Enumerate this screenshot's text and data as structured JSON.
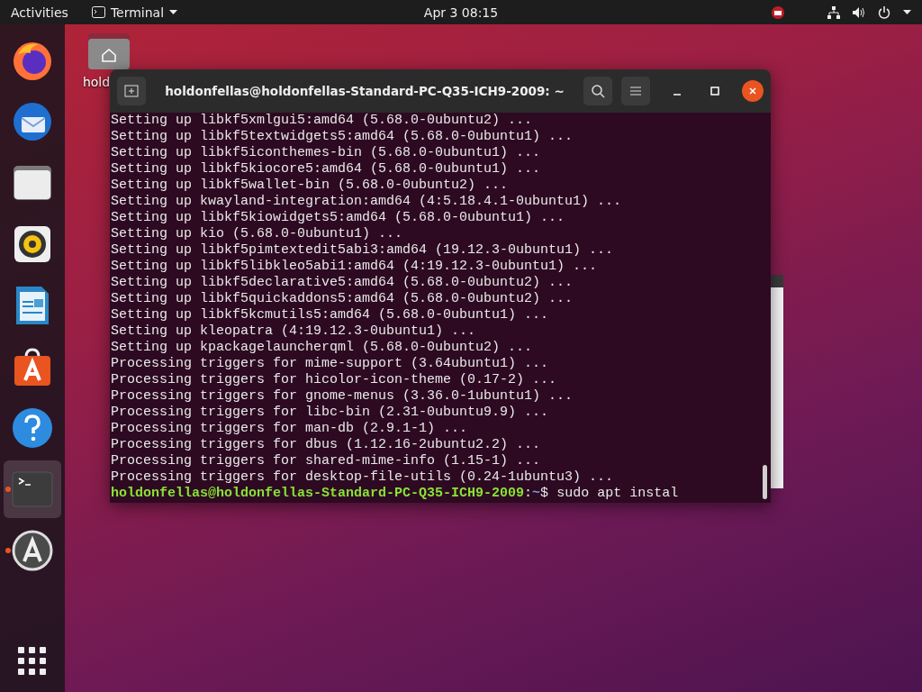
{
  "top_bar": {
    "activities": "Activities",
    "app_menu": "Terminal",
    "clock": "Apr 3  08:15"
  },
  "dock": {
    "items": [
      {
        "kind": "firefox",
        "running": false,
        "selected": false
      },
      {
        "kind": "mail",
        "running": false,
        "selected": false
      },
      {
        "kind": "files",
        "running": false,
        "selected": false
      },
      {
        "kind": "music",
        "running": false,
        "selected": false
      },
      {
        "kind": "writer",
        "running": false,
        "selected": false
      },
      {
        "kind": "store",
        "running": false,
        "selected": false
      },
      {
        "kind": "help",
        "running": false,
        "selected": false
      },
      {
        "kind": "terminal",
        "running": true,
        "selected": true
      },
      {
        "kind": "updater",
        "running": true,
        "selected": false
      }
    ]
  },
  "desktop_icon": {
    "label": "hold"
  },
  "terminal": {
    "title": "holdonfellas@holdonfellas-Standard-PC-Q35-ICH9-2009: ~",
    "lines": [
      "Setting up libkf5xmlgui5:amd64 (5.68.0-0ubuntu2) ...",
      "Setting up libkf5textwidgets5:amd64 (5.68.0-0ubuntu1) ...",
      "Setting up libkf5iconthemes-bin (5.68.0-0ubuntu1) ...",
      "Setting up libkf5kiocore5:amd64 (5.68.0-0ubuntu1) ...",
      "Setting up libkf5wallet-bin (5.68.0-0ubuntu2) ...",
      "Setting up kwayland-integration:amd64 (4:5.18.4.1-0ubuntu1) ...",
      "Setting up libkf5kiowidgets5:amd64 (5.68.0-0ubuntu1) ...",
      "Setting up kio (5.68.0-0ubuntu1) ...",
      "Setting up libkf5pimtextedit5abi3:amd64 (19.12.3-0ubuntu1) ...",
      "Setting up libkf5libkleo5abi1:amd64 (4:19.12.3-0ubuntu1) ...",
      "Setting up libkf5declarative5:amd64 (5.68.0-0ubuntu2) ...",
      "Setting up libkf5quickaddons5:amd64 (5.68.0-0ubuntu2) ...",
      "Setting up libkf5kcmutils5:amd64 (5.68.0-0ubuntu1) ...",
      "Setting up kleopatra (4:19.12.3-0ubuntu1) ...",
      "Setting up kpackagelauncherqml (5.68.0-0ubuntu2) ...",
      "Processing triggers for mime-support (3.64ubuntu1) ...",
      "Processing triggers for hicolor-icon-theme (0.17-2) ...",
      "Processing triggers for gnome-menus (3.36.0-1ubuntu1) ...",
      "Processing triggers for libc-bin (2.31-0ubuntu9.9) ...",
      "Processing triggers for man-db (2.9.1-1) ...",
      "Processing triggers for dbus (1.12.16-2ubuntu2.2) ...",
      "Processing triggers for shared-mime-info (1.15-1) ...",
      "Processing triggers for desktop-file-utils (0.24-1ubuntu3) ..."
    ],
    "prompt": {
      "user_host": "holdonfellas@holdonfellas-Standard-PC-Q35-ICH9-2009",
      "separator": ":",
      "path": "~",
      "symbol": "$",
      "command": "sudo apt instal"
    }
  }
}
